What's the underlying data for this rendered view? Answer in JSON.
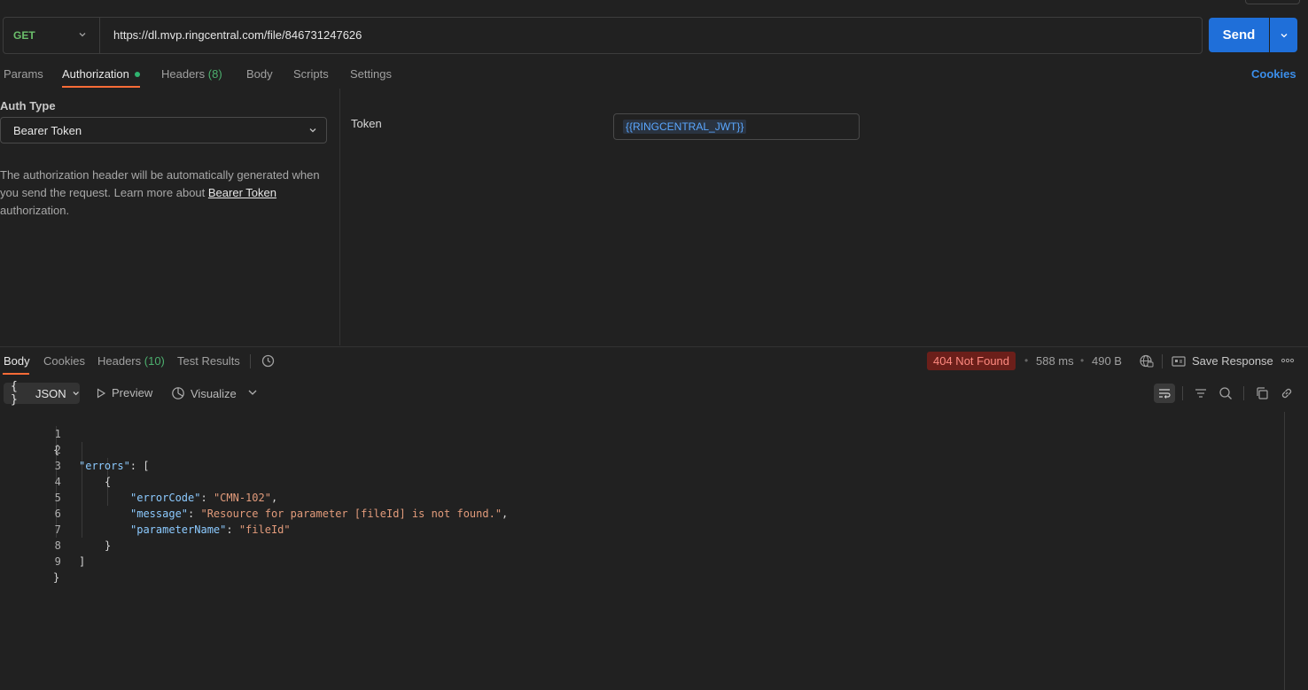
{
  "request": {
    "method": "GET",
    "url": "https://dl.mvp.ringcentral.com/file/846731247626",
    "send_label": "Send"
  },
  "request_tabs": {
    "params": "Params",
    "authorization": "Authorization",
    "headers": "Headers",
    "headers_count": "(8)",
    "body": "Body",
    "scripts": "Scripts",
    "settings": "Settings",
    "cookies": "Cookies"
  },
  "auth": {
    "type_label": "Auth Type",
    "type_value": "Bearer Token",
    "desc_before": "The authorization header will be automatically generated when you send the request. Learn more about ",
    "desc_link": "Bearer Token",
    "desc_after": " authorization.",
    "token_label": "Token",
    "token_value": "{{RINGCENTRAL_JWT}}"
  },
  "response_tabs": {
    "body": "Body",
    "cookies": "Cookies",
    "headers": "Headers",
    "headers_count": "(10)",
    "test_results": "Test Results"
  },
  "response_meta": {
    "status": "404 Not Found",
    "time": "588 ms",
    "size": "490 B",
    "save_response": "Save Response"
  },
  "body_toolbar": {
    "format": "JSON",
    "preview": "Preview",
    "visualize": "Visualize"
  },
  "code": {
    "line_numbers": [
      "1",
      "2",
      "3",
      "4",
      "5",
      "6",
      "7",
      "8",
      "9"
    ],
    "l1": "{",
    "l2_key": "\"errors\"",
    "l2_rest": ": [",
    "l3": "{",
    "l4_key": "\"errorCode\"",
    "l4_val": "\"CMN-102\"",
    "l5_key": "\"message\"",
    "l5_val": "\"Resource for parameter [fileId] is not found.\"",
    "l6_key": "\"parameterName\"",
    "l6_val": "\"fileId\"",
    "l7": "}",
    "l8": "]",
    "l9": "}"
  },
  "icons": {
    "method_dropdown": "chevron-down-icon",
    "send_dropdown": "chevron-down-icon",
    "history": "history-icon",
    "globe": "globe-icon",
    "save": "save-icon",
    "more": "more-icon",
    "wrap": "wrap-lines-icon",
    "filter": "filter-icon",
    "search": "search-icon",
    "copy": "copy-icon",
    "link": "link-icon"
  },
  "colors": {
    "accent": "#ff6c37",
    "send": "#1f6fd9",
    "status_bg": "#6b1f1a",
    "method": "#6bbf6b"
  }
}
